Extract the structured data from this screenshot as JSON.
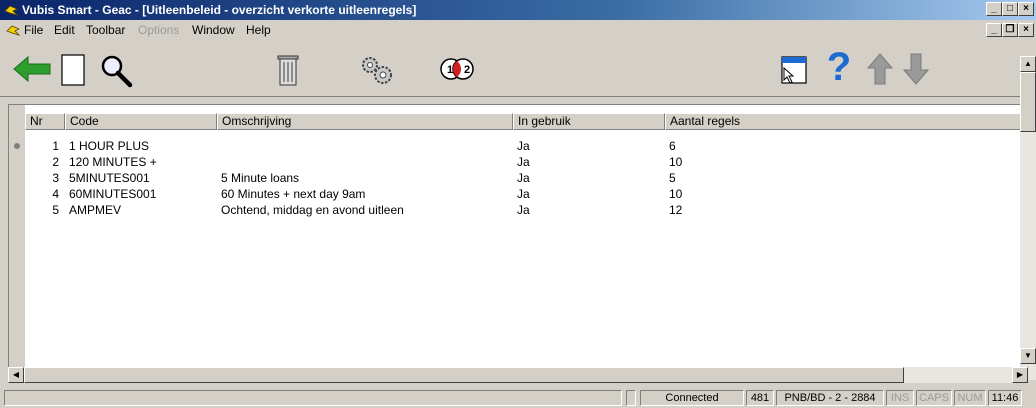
{
  "window": {
    "title": "Vubis Smart - Geac - [Uitleenbeleid - overzicht verkorte uitleenregels]",
    "buttons": {
      "minimize": "_",
      "maximize": "□",
      "close": "×"
    }
  },
  "menu": {
    "items": [
      {
        "label": "File",
        "enabled": true
      },
      {
        "label": "Edit",
        "enabled": true
      },
      {
        "label": "Toolbar",
        "enabled": true
      },
      {
        "label": "Options",
        "enabled": false
      },
      {
        "label": "Window",
        "enabled": true
      },
      {
        "label": "Help",
        "enabled": true
      }
    ],
    "child_buttons": {
      "minimize": "_",
      "restore": "❐",
      "close": "×"
    }
  },
  "toolbar": {
    "icons": [
      "back-arrow-icon",
      "new-document-icon",
      "search-icon",
      "trash-icon",
      "gears-icon",
      "one-two-icon",
      "form-pointer-icon",
      "help-question-icon",
      "up-arrow-icon",
      "down-arrow-icon"
    ],
    "help_glyph": "?",
    "accent_green": "#2e9e2e",
    "accent_blue": "#1d6bd1",
    "accent_grey": "#9a9a9a"
  },
  "table": {
    "columns": [
      "Nr",
      "Code",
      "Omschrijving",
      "In gebruik",
      "Aantal regels"
    ],
    "rows": [
      {
        "nr": "1",
        "code": "1 HOUR PLUS",
        "desc": "",
        "in_use": "Ja",
        "count": "6"
      },
      {
        "nr": "2",
        "code": "120 MINUTES +",
        "desc": "",
        "in_use": "Ja",
        "count": "10"
      },
      {
        "nr": "3",
        "code": "5MINUTES001",
        "desc": "5 Minute loans",
        "in_use": "Ja",
        "count": "5"
      },
      {
        "nr": "4",
        "code": "60MINUTES001",
        "desc": "60 Minutes + next day 9am",
        "in_use": "Ja",
        "count": "10"
      },
      {
        "nr": "5",
        "code": "AMPMEV",
        "desc": "Ochtend, middag en avond uitleen",
        "in_use": "Ja",
        "count": "12"
      }
    ]
  },
  "status": {
    "connection": "Connected",
    "count": "481",
    "location": "PNB/BD - 2 - 2884",
    "ins": "INS",
    "caps": "CAPS",
    "num": "NUM",
    "time": "11:46"
  }
}
